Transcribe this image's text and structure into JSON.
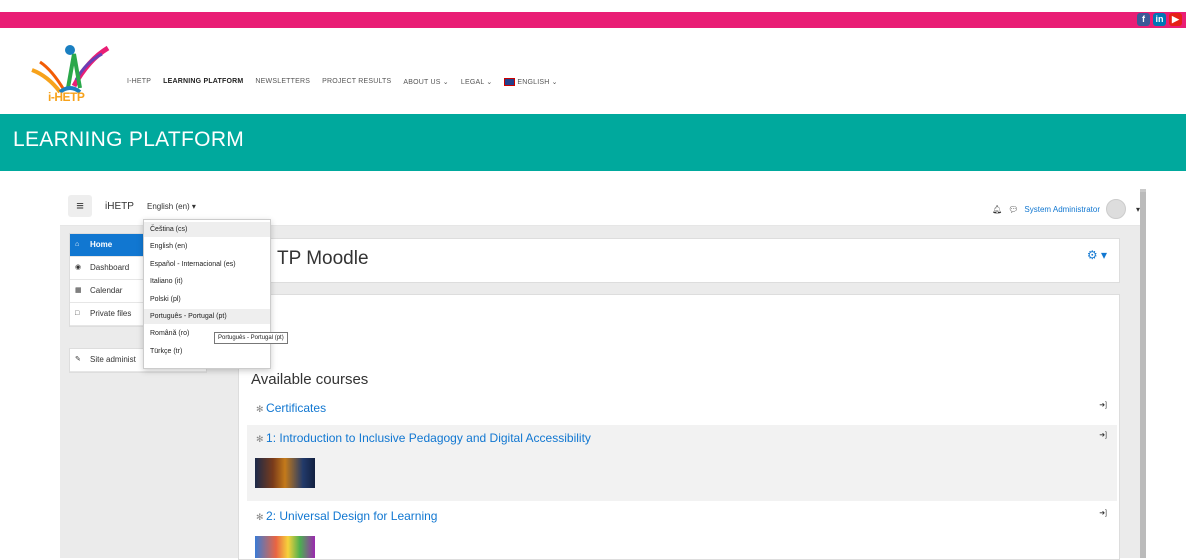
{
  "social": {
    "facebook": "f",
    "linkedin": "in",
    "youtube": "▶"
  },
  "logo": {
    "text": "i-HETP"
  },
  "nav": [
    "I-HETP",
    "LEARNING PLATFORM",
    "NEWSLETTERS",
    "PROJECT RESULTS",
    "ABOUT US ⌄",
    "LEGAL ⌄",
    "ENGLISH ⌄"
  ],
  "banner": {
    "title": "LEARNING PLATFORM"
  },
  "moodle": {
    "brand": "iHETP",
    "language": "English (en) ▾",
    "user": "System Administrator",
    "sidebar": [
      "Home",
      "Dashboard",
      "Calendar",
      "Private files"
    ],
    "site_admin": "Site administ",
    "page_title": "TP Moodle",
    "available_courses": "Available courses",
    "courses": [
      "Certificates",
      "1: Introduction to Inclusive Pedagogy and Digital Accessibility",
      "2: Universal Design for Learning"
    ]
  },
  "languages": [
    "Čeština (cs)",
    "English (en)",
    "Español - Internacional (es)",
    "Italiano (it)",
    "Polski (pl)",
    "Português - Portugal (pt)",
    "Română (ro)",
    "Türkçe (tr)"
  ],
  "tooltip": "Português - Portugal (pt)",
  "colors": {
    "topbar": "#e91e75",
    "banner": "#00a99d",
    "accent": "#1177d1"
  }
}
